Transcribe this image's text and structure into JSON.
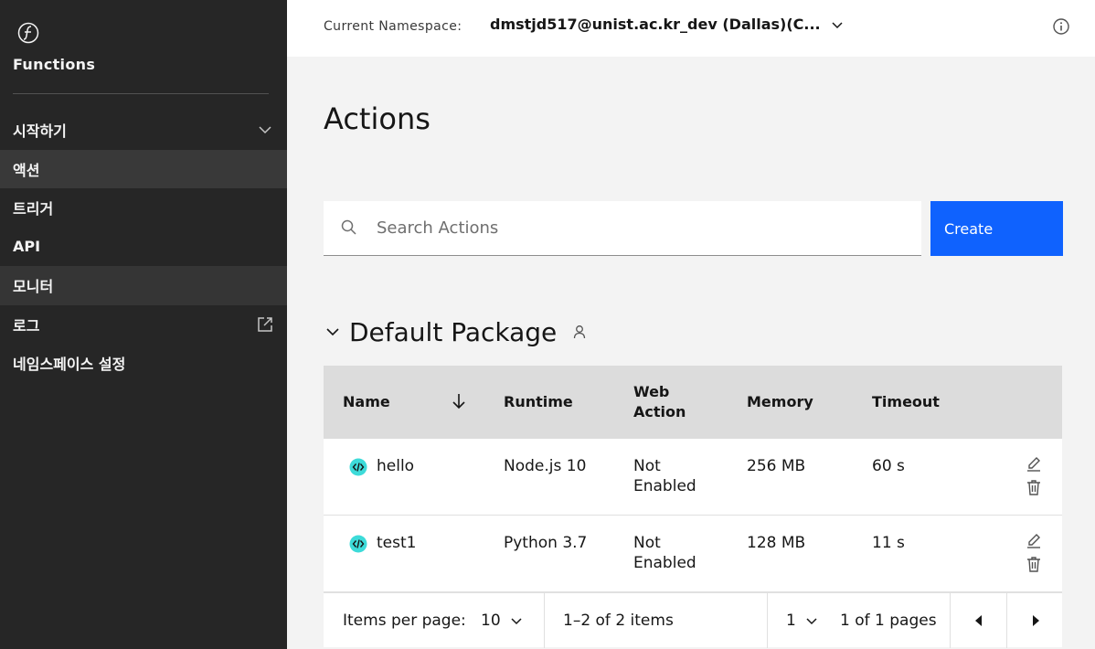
{
  "sidebar": {
    "title": "Functions",
    "items": [
      {
        "label": "시작하기"
      },
      {
        "label": "액션"
      },
      {
        "label": "트리거"
      },
      {
        "label": "API"
      },
      {
        "label": "모니터"
      },
      {
        "label": "로그"
      },
      {
        "label": "네임스페이스 설정"
      }
    ]
  },
  "header": {
    "namespace_label": "Current Namespace:",
    "namespace_value": "dmstjd517@unist.ac.kr_dev (Dallas)(C..."
  },
  "main": {
    "title": "Actions",
    "search_placeholder": "Search Actions",
    "create_label": "Create",
    "package_title": "Default Package"
  },
  "table": {
    "columns": [
      "Name",
      "Runtime",
      "Web Action",
      "Memory",
      "Timeout"
    ],
    "rows": [
      {
        "name": "hello",
        "runtime": "Node.js 10",
        "web_action": "Not Enabled",
        "memory": "256 MB",
        "timeout": "60 s"
      },
      {
        "name": "test1",
        "runtime": "Python 3.7",
        "web_action": "Not Enabled",
        "memory": "128 MB",
        "timeout": "11 s"
      }
    ]
  },
  "pagination": {
    "items_per_page_label": "Items per page:",
    "items_per_page_value": "10",
    "range_text": "1–2 of 2 items",
    "page_value": "1",
    "pages_text": "1 of 1 pages"
  },
  "colors": {
    "sidebar_bg": "#262626",
    "accent": "#0f62fe",
    "action_icon": "#3ddbd9"
  }
}
